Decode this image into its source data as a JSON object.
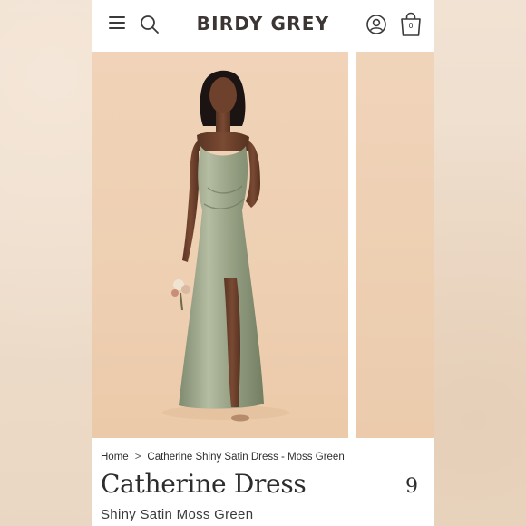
{
  "header": {
    "brand": "BIRDY GREY",
    "cart_count": "0",
    "icons": [
      "menu-icon",
      "search-icon",
      "account-icon",
      "bag-icon"
    ]
  },
  "gallery": {
    "colors": {
      "backdrop": "#eecfb2",
      "dress": "#9aa48a"
    }
  },
  "breadcrumb": {
    "home": "Home",
    "separator": ">",
    "current": "Catherine Shiny Satin Dress - Moss Green"
  },
  "product": {
    "title": "Catherine Dress",
    "price_partial": "9",
    "subtitle": "Shiny Satin Moss Green"
  },
  "chat": {
    "icon": "chat-bubble-icon",
    "color": "#6b605e"
  }
}
